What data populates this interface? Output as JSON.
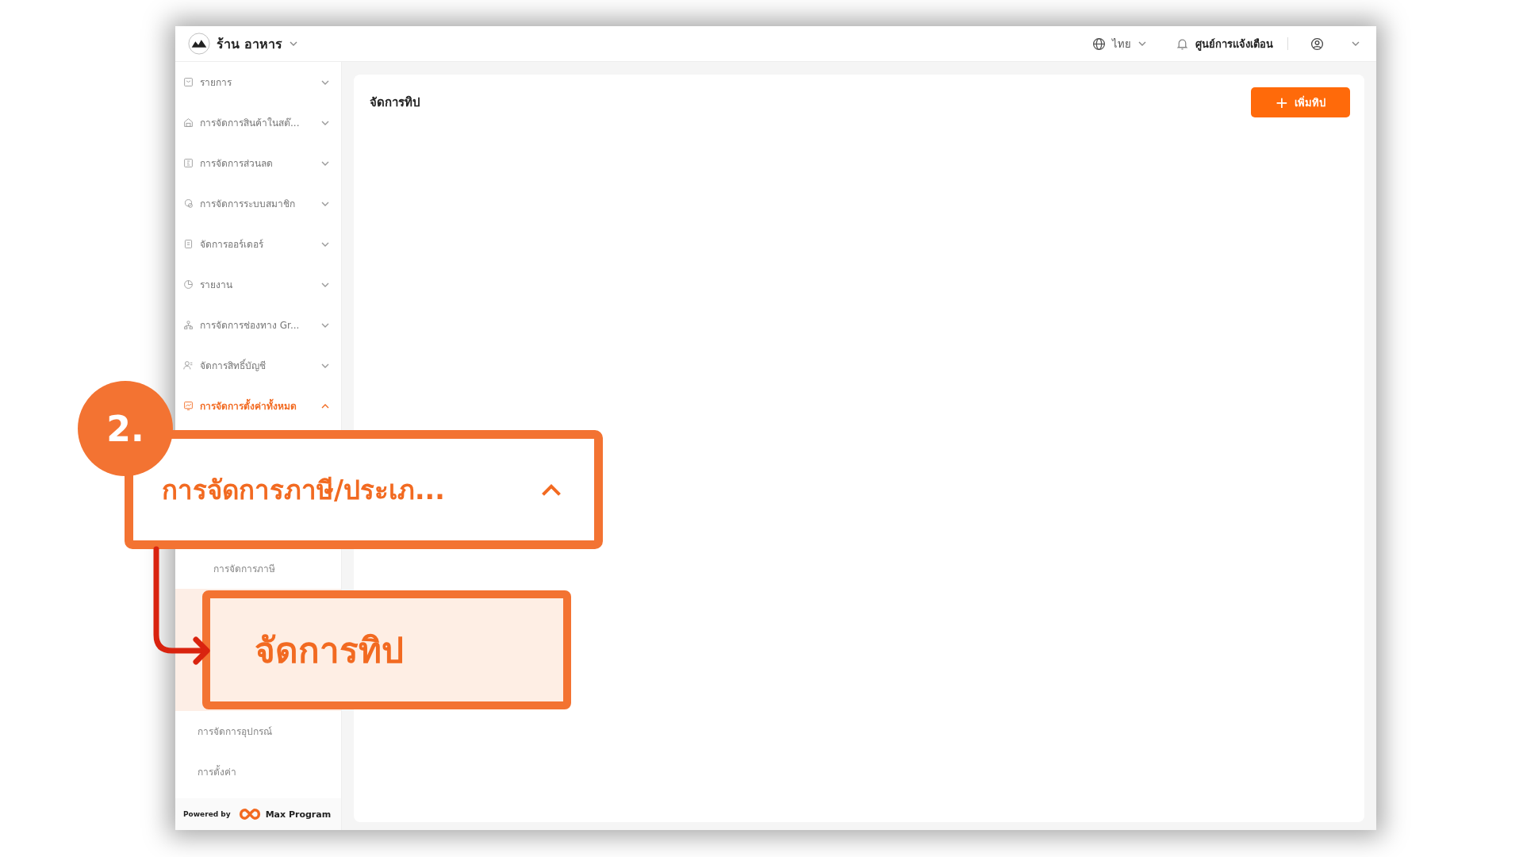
{
  "topbar": {
    "store": "ร้าน อาหาร",
    "language": "ไทย",
    "notifications": "ศูนย์การแจ้งเตือน"
  },
  "sidebar": {
    "items": [
      {
        "label": "รายการ",
        "expanded": false,
        "selected": false
      },
      {
        "label": "การจัดการสินค้าในสต๊...",
        "expanded": false,
        "selected": false
      },
      {
        "label": "การจัดการส่วนลด",
        "expanded": false,
        "selected": false
      },
      {
        "label": "การจัดการระบบสมาชิก",
        "expanded": false,
        "selected": false
      },
      {
        "label": "จัดการออร์เดอร์",
        "expanded": false,
        "selected": false
      },
      {
        "label": "รายงาน",
        "expanded": false,
        "selected": false
      },
      {
        "label": "การจัดการช่องทาง Gr...",
        "expanded": false,
        "selected": false
      },
      {
        "label": "จัดการสิทธิ์บัญชี",
        "expanded": false,
        "selected": false
      },
      {
        "label": "การจัดการตั้งค่าทั้งหมด",
        "expanded": true,
        "selected": true,
        "children": [
          {
            "label": "การจัดการภาษี/ประเภ...",
            "expanded": true,
            "callout": true,
            "step": "2.",
            "children": [
              {
                "label": "การจัดการภาษี",
                "selected": false,
                "callout": false
              },
              {
                "label": "จัดการทิป",
                "selected": true,
                "callout": true
              }
            ]
          },
          {
            "label": "การจัดการอุปกรณ์",
            "selected": false,
            "callout": false
          },
          {
            "label": "การตั้งค่า",
            "selected": false,
            "callout": false
          }
        ]
      }
    ],
    "footer": {
      "prefix": "Powered by",
      "brand": "Max Program"
    }
  },
  "page": {
    "title": "จัดการทิป",
    "add_button": {
      "icon": "+",
      "label": "เพิ่มทิป"
    }
  }
}
